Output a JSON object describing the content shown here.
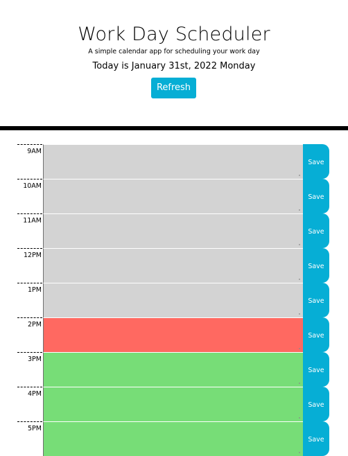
{
  "header": {
    "title": "Work Day Scheduler",
    "lead": "A simple calendar app for scheduling your work day",
    "current_day": "Today is January 31st, 2022 Monday",
    "refresh_label": "Refresh"
  },
  "colors": {
    "past": "#d3d3d3",
    "present": "#ff6961",
    "future": "#77dd77",
    "button": "#06aed5"
  },
  "blocks": [
    {
      "hour": "9AM",
      "state": "past",
      "text": "",
      "save_label": "Save"
    },
    {
      "hour": "10AM",
      "state": "past",
      "text": "",
      "save_label": "Save"
    },
    {
      "hour": "11AM",
      "state": "past",
      "text": "",
      "save_label": "Save"
    },
    {
      "hour": "12PM",
      "state": "past",
      "text": "",
      "save_label": "Save"
    },
    {
      "hour": "1PM",
      "state": "past",
      "text": "",
      "save_label": "Save"
    },
    {
      "hour": "2PM",
      "state": "present",
      "text": "",
      "save_label": "Save"
    },
    {
      "hour": "3PM",
      "state": "future",
      "text": "",
      "save_label": "Save"
    },
    {
      "hour": "4PM",
      "state": "future",
      "text": "",
      "save_label": "Save"
    },
    {
      "hour": "5PM",
      "state": "future",
      "text": "",
      "save_label": "Save"
    }
  ]
}
